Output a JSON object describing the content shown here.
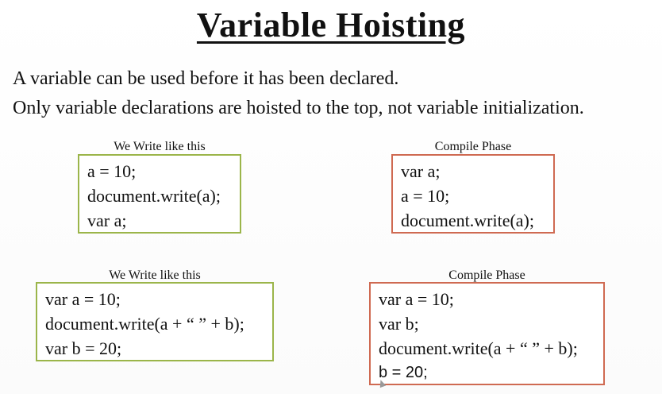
{
  "title": "Variable Hoisting",
  "intro": {
    "line1": "A variable can be used before it has been declared.",
    "line2": "Only variable declarations are hoisted to the top, not variable initialization."
  },
  "example1": {
    "written": {
      "caption": "We Write like this",
      "lines": [
        "a = 10;",
        "document.write(a);",
        "var a;"
      ]
    },
    "compiled": {
      "caption": "Compile Phase",
      "lines": [
        "var a;",
        "a = 10;",
        "document.write(a);"
      ]
    }
  },
  "example2": {
    "written": {
      "caption": "We Write like this",
      "lines": [
        "var a = 10;",
        "document.write(a + “ ” + b);",
        "var b = 20;"
      ]
    },
    "compiled": {
      "caption": "Compile Phase",
      "lines": [
        "var a = 10;",
        "var b;",
        "document.write(a + “ ” + b);",
        "b = 20;"
      ]
    }
  },
  "colors": {
    "written_border": "#9bb54a",
    "compiled_border": "#cf6a52"
  }
}
